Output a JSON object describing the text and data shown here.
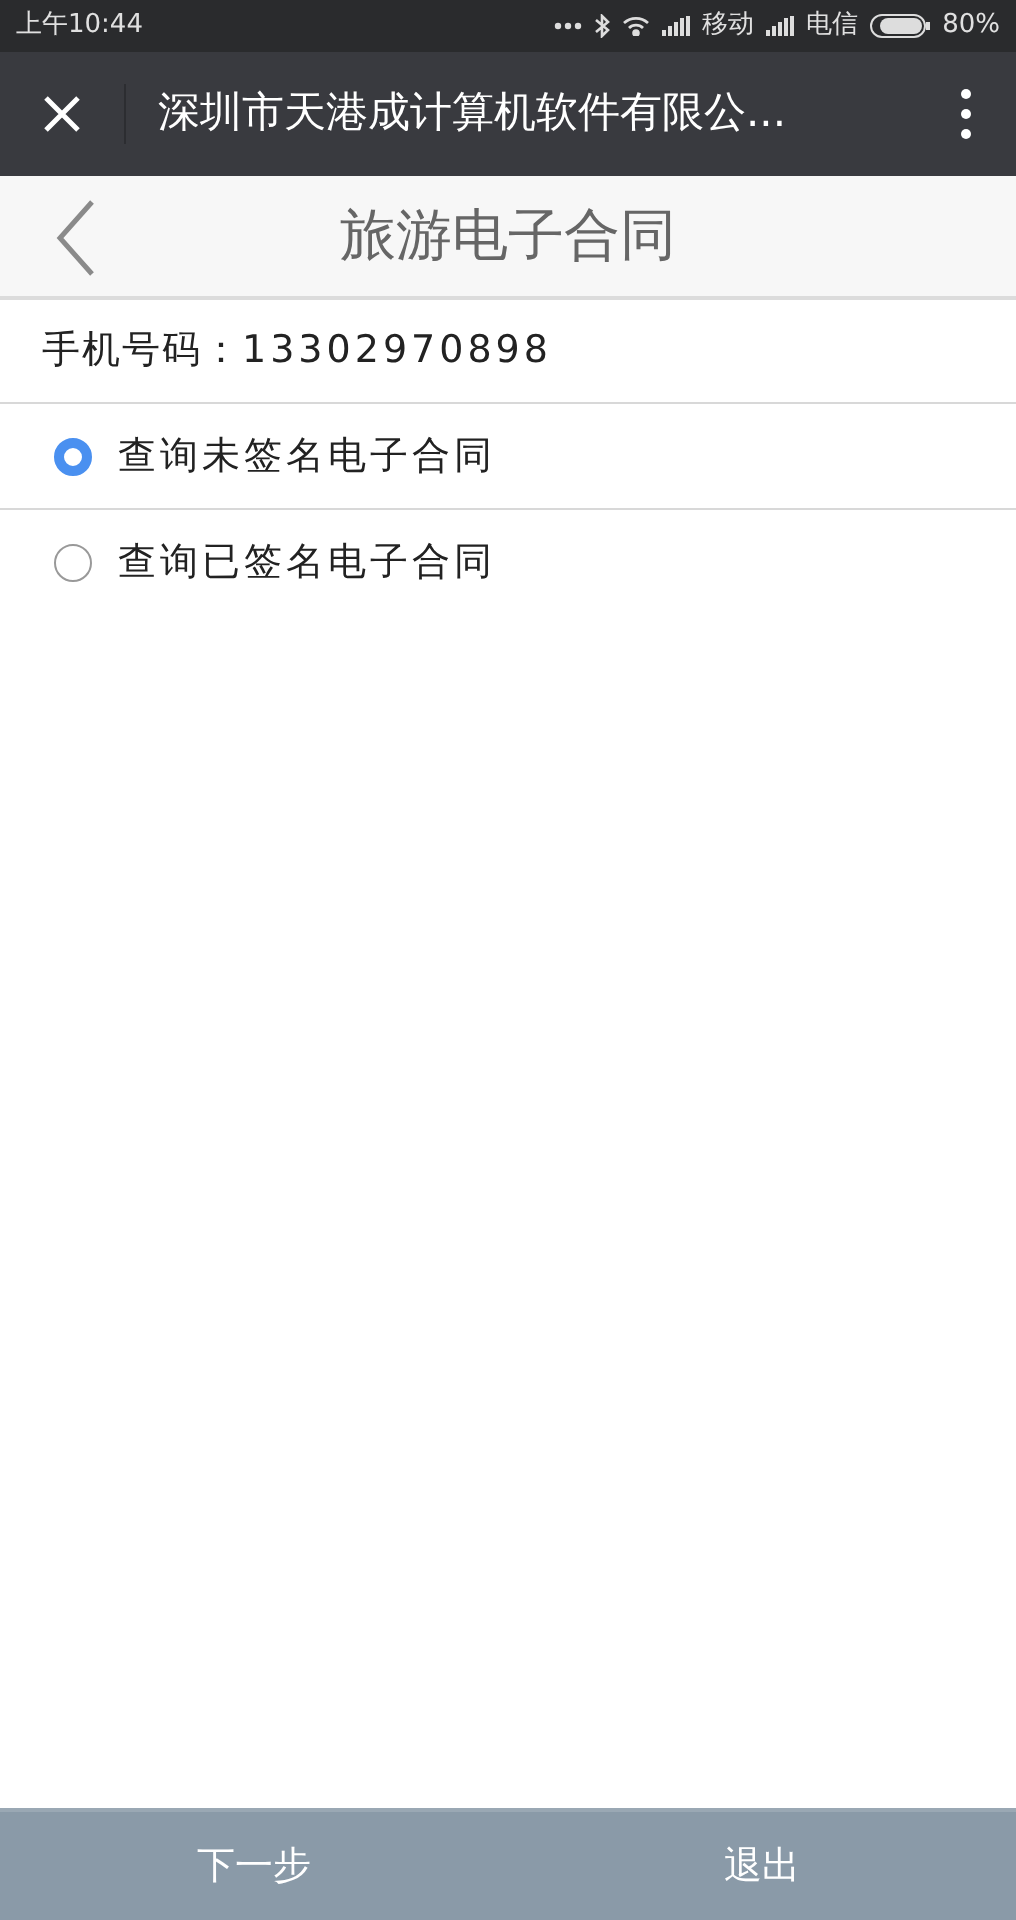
{
  "status_bar": {
    "time": "上午10:44",
    "carrier_1": "移动",
    "carrier_2": "电信",
    "battery": "80%"
  },
  "toolbar": {
    "title": "深圳市天港成计算机软件有限公..."
  },
  "header": {
    "title": "旅游电子合同"
  },
  "phone": {
    "label": "手机号码：",
    "value": "13302970898"
  },
  "options": [
    {
      "label": "查询未签名电子合同",
      "selected": true
    },
    {
      "label": "查询已签名电子合同",
      "selected": false
    }
  ],
  "buttons": [
    "下一步",
    "退出"
  ]
}
